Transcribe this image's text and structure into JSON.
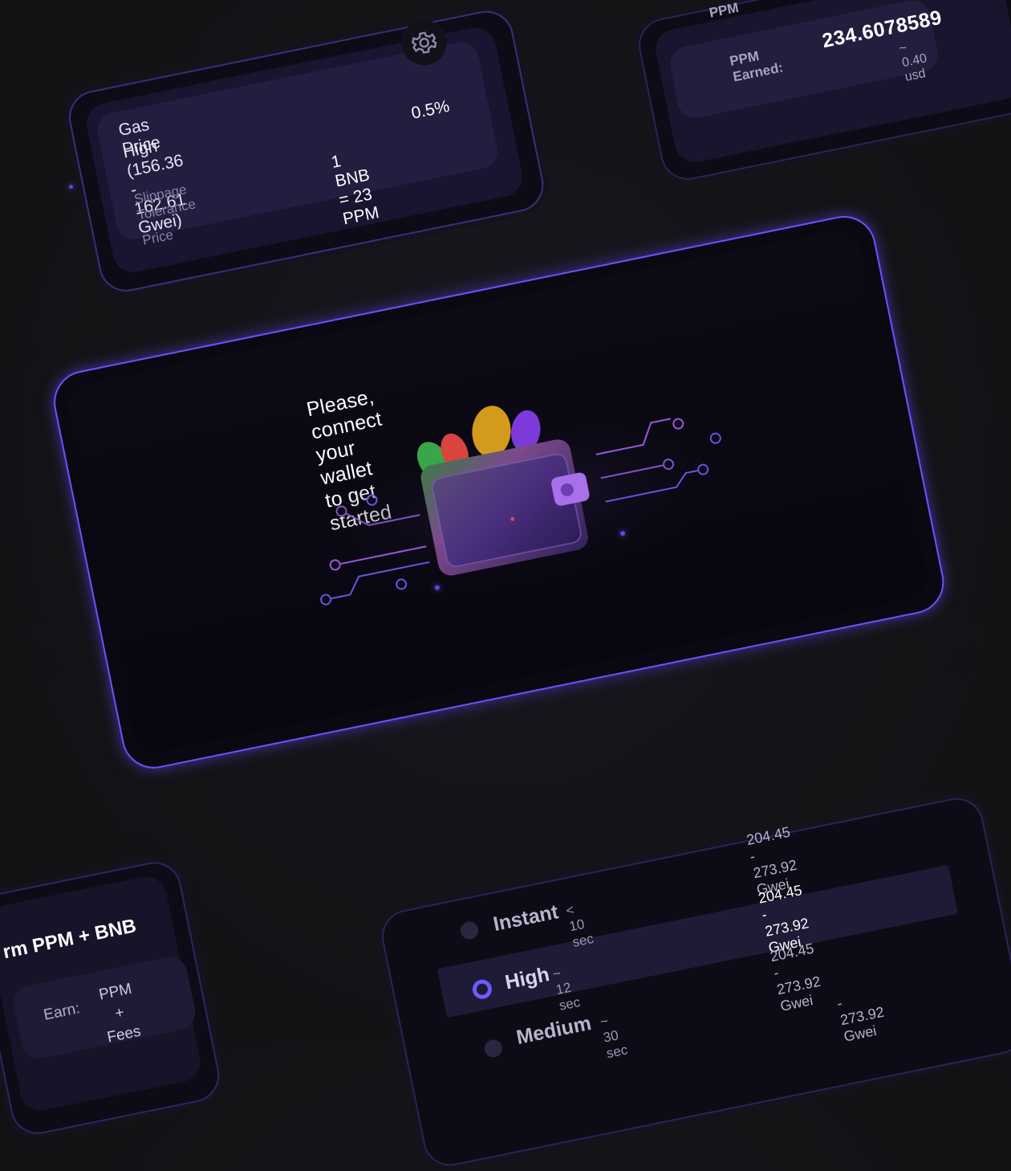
{
  "gas_card": {
    "title": "Gas Price",
    "range": "High (156.36 - 162.61 Gwei)",
    "slippage_label": "Slippage Tolerance",
    "slippage_value": "0.5%",
    "price_label": "Price",
    "price_value": "1 BNB = 23 PPM",
    "settings_icon": "gear-icon"
  },
  "earned_card": {
    "top_label": "PPM",
    "label": "PPM Earned:",
    "value": "234.6078589",
    "usd": "~ 0.40 usd"
  },
  "main_card": {
    "message": "Please, connect your wallet to get started",
    "illustration": "wallet-icon",
    "accent": "#6a52ff"
  },
  "earn_card": {
    "title": "rm PPM + BNB",
    "earn_label": "Earn:",
    "earn_value_line1": "PPM +",
    "earn_value_line2": "Fees"
  },
  "speed_card": {
    "options": [
      {
        "name": "Instant",
        "time": "< 10 sec",
        "range": "204.45 - 273.92 Gwei",
        "selected": false
      },
      {
        "name": "High",
        "time": "~ 12 sec",
        "range": "204.45 - 273.92 Gwei",
        "selected": true
      },
      {
        "name": "Medium",
        "time": "~ 30 sec",
        "range": "204.45 - 273.92 Gwei",
        "selected": false
      },
      {
        "name": "",
        "time": "",
        "range": "- 273.92 Gwei",
        "selected": false
      }
    ]
  }
}
